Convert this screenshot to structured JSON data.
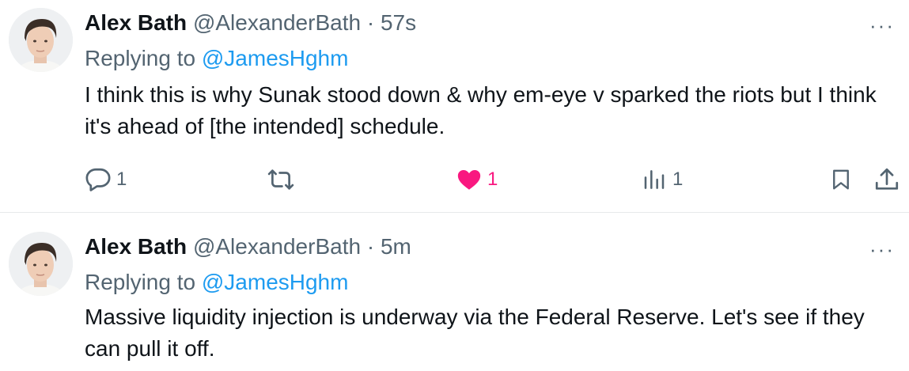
{
  "tweets": [
    {
      "author_name": "Alex Bath",
      "handle": "@AlexanderBath",
      "separator": "·",
      "time": "57s",
      "replying_prefix": "Replying to",
      "replying_to": "@JamesHghm",
      "text": "I think this is why Sunak stood down  & why em-eye v sparked the riots but I think it's ahead of [the intended] schedule.",
      "more": "···",
      "actions": {
        "replies": "1",
        "retweets": "",
        "likes": "1",
        "views": "1",
        "liked": true
      }
    },
    {
      "author_name": "Alex Bath",
      "handle": "@AlexanderBath",
      "separator": "·",
      "time": "5m",
      "replying_prefix": "Replying to",
      "replying_to": "@JamesHghm",
      "text": "Massive liquidity injection is underway via the Federal Reserve. Let's see if they can pull it off.",
      "more": "···"
    }
  ],
  "colors": {
    "text": "#0f1419",
    "secondary": "#536471",
    "link": "#1d9bf0",
    "like": "#f91880",
    "divider": "#e6e9eb"
  },
  "icons": [
    "reply-icon",
    "retweet-icon",
    "like-icon",
    "views-icon",
    "bookmark-icon",
    "share-icon",
    "more-icon"
  ]
}
